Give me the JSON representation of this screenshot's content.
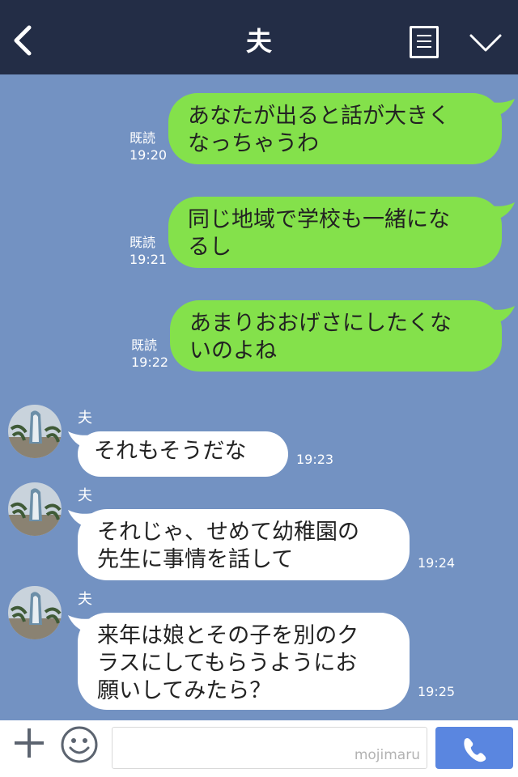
{
  "header": {
    "title": "夫"
  },
  "messages_sent": [
    {
      "read": "既読",
      "time": "19:20",
      "text_line1": "あなたが出ると話が大きく",
      "text_line2": "なっちゃうわ"
    },
    {
      "read": "既読",
      "time": "19:21",
      "text_line1": "同じ地域で学校も一緒にな",
      "text_line2": "るし"
    },
    {
      "read": "既読",
      "time": "19:22",
      "text_line1": "あまりおおげさにしたくな",
      "text_line2": "いのよね"
    }
  ],
  "messages_received": [
    {
      "sender": "夫",
      "time": "19:23",
      "text_line1": "それもそうだな"
    },
    {
      "sender": "夫",
      "time": "19:24",
      "text_line1": "それじゃ、せめて幼稚園の",
      "text_line2": "先生に事情を話して"
    },
    {
      "sender": "夫",
      "time": "19:25",
      "text_line1": "来年は娘とその子を別のク",
      "text_line2": "ラスにしてもらうようにお",
      "text_line3": "願いしてみたら？"
    }
  ],
  "input": {
    "watermark": "mojimaru"
  },
  "icons": {
    "back": "chevron-left-icon",
    "menu": "menu-list-icon",
    "expand": "chevron-down-icon",
    "add": "plus-icon",
    "emoji": "smiley-icon",
    "call": "phone-icon"
  },
  "colors": {
    "header_bg": "#232d46",
    "chat_bg": "#7392c2",
    "sent_bubble": "#84e14b",
    "received_bubble": "#ffffff",
    "call_button": "#5a86e0"
  }
}
